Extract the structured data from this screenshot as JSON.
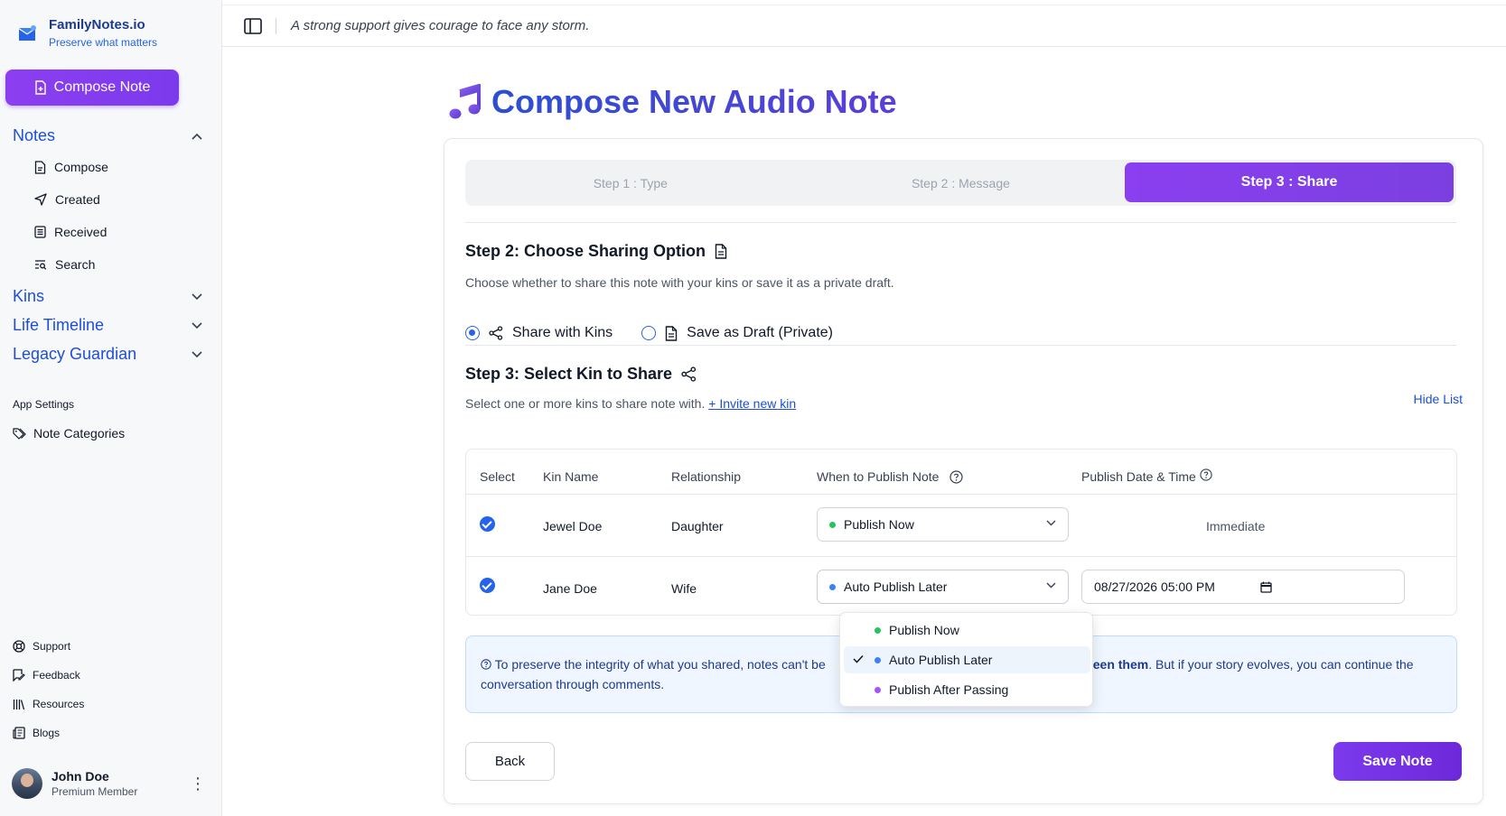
{
  "brand": {
    "name": "FamilyNotes.io",
    "tagline": "Preserve what matters"
  },
  "sidebar": {
    "compose_button": "Compose Note",
    "groups": [
      {
        "label": "Notes",
        "items": [
          "Compose",
          "Created",
          "Received",
          "Search"
        ]
      },
      {
        "label": "Kins"
      },
      {
        "label": "Life Timeline"
      },
      {
        "label": "Legacy Guardian"
      }
    ],
    "settings_title": "App Settings",
    "settings_item": "Note Categories",
    "footer_items": [
      "Support",
      "Feedback",
      "Resources",
      "Blogs"
    ],
    "user": {
      "name": "John Doe",
      "role": "Premium Member"
    }
  },
  "topbar": {
    "quote": "A strong support gives courage to face any storm."
  },
  "page": {
    "title": "Compose New Audio Note"
  },
  "stepper": {
    "steps": [
      "Step 1 : Type",
      "Step 2 : Message",
      "Step 3 : Share"
    ],
    "active": 2
  },
  "sharing": {
    "title": "Step 2: Choose Sharing Option",
    "description": "Choose whether to share this note with your kins or save it as a private draft.",
    "options": [
      "Share with Kins",
      "Save as Draft (Private)"
    ],
    "selected": 0
  },
  "kin_select": {
    "title": "Step 3: Select Kin to Share",
    "hide_list": "Hide List",
    "description": "Select one or more kins to share note with.",
    "invite_link": "+ Invite new kin",
    "columns": [
      "Select",
      "Kin Name",
      "Relationship",
      "When to Publish Note",
      "Publish Date & Time"
    ],
    "rows": [
      {
        "name": "Jewel Doe",
        "relationship": "Daughter",
        "publish": "Publish Now",
        "publish_color": "#22c55e",
        "date": "Immediate"
      },
      {
        "name": "Jane Doe",
        "relationship": "Wife",
        "publish": "Auto Publish Later",
        "publish_color": "#3b82f6",
        "date": "08/27/2026 05:00 PM"
      }
    ]
  },
  "info": {
    "text_start": "To preserve the integrity of what you shared, notes can't be",
    "text_bold": "een them",
    "text_end": ". But if your story evolves, you can continue the conversation through comments."
  },
  "buttons": {
    "back": "Back",
    "save": "Save Note"
  },
  "dropdown": {
    "options": [
      {
        "label": "Publish Now",
        "color": "#22c55e"
      },
      {
        "label": "Auto Publish Later",
        "color": "#3b82f6"
      },
      {
        "label": "Publish After Passing",
        "color": "#a855f7"
      }
    ],
    "selected": 1
  }
}
